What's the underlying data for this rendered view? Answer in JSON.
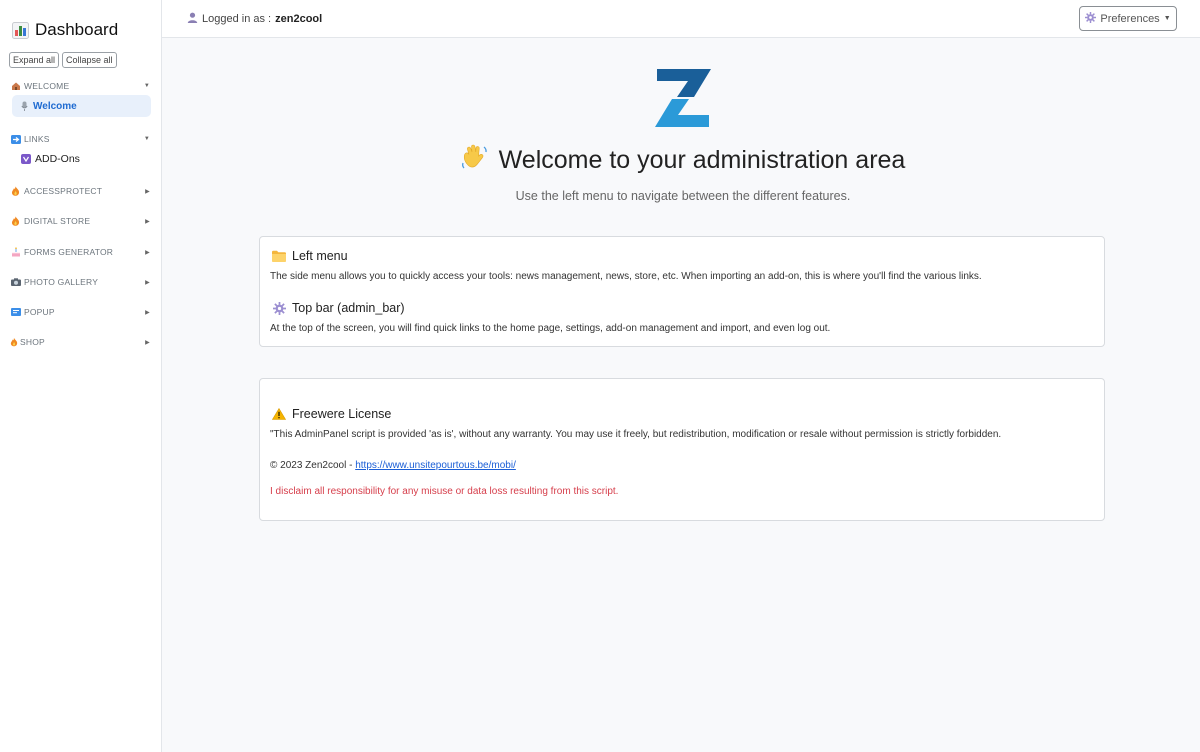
{
  "sidebar": {
    "title": "Dashboard",
    "expand_all": "Expand all",
    "collapse_all": "Collapse all",
    "sections": [
      {
        "label": "WELCOME",
        "icon": "house-icon"
      },
      {
        "label": "LINKS",
        "icon": "arrow-right-icon"
      },
      {
        "label": "ACCESSPROTECT",
        "icon": "fire-icon"
      },
      {
        "label": "DIGITAL STORE",
        "icon": "fire-icon"
      },
      {
        "label": "FORMS GENERATOR",
        "icon": "cake-icon"
      },
      {
        "label": "PHOTO GALLERY",
        "icon": "camera-icon"
      },
      {
        "label": "POPUP",
        "icon": "popup-icon"
      },
      {
        "label": "SHOP",
        "icon": "fire-icon"
      }
    ],
    "welcome_item": "Welcome",
    "addons_item": "ADD-Ons"
  },
  "topbar": {
    "logged_prefix": "Logged in as :",
    "username": "zen2cool",
    "preferences": "Preferences"
  },
  "main": {
    "title": "Welcome to your administration area",
    "subtitle": "Use the left menu to navigate between the different features.",
    "left_menu_title": "Left menu",
    "left_menu_text": "The side menu allows you to quickly access your tools: news management, news, store, etc. When importing an add-on, this is where you'll find the various links.",
    "top_bar_title": "Top bar (admin_bar)",
    "top_bar_text": "At the top of the screen, you will find quick links to the home page, settings, add-on management and import, and even log out.",
    "license_title": "Freewere License",
    "license_text": "\"This AdminPanel script is provided 'as is', without any warranty. You may use it freely, but redistribution, modification or resale without permission is strictly forbidden.",
    "copyright": "© 2023 Zen2cool - ",
    "link": "https://www.unsitepourtous.be/mobi/",
    "disclaimer": "I disclaim all responsibility for any misuse or data loss resulting from this script."
  },
  "colors": {
    "accent": "#1f6bd1",
    "warning_text": "#d63e4b",
    "logo_dark": "#1a5f99",
    "logo_light": "#2b9ad8"
  }
}
